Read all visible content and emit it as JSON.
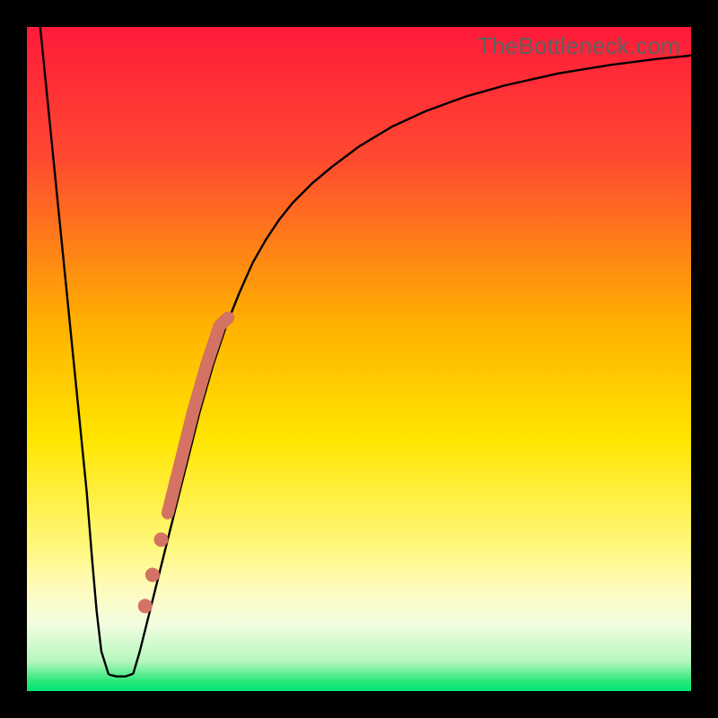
{
  "watermark": "TheBottleneck.com",
  "chart_data": {
    "type": "line",
    "title": "",
    "xlabel": "",
    "ylabel": "",
    "xlim": [
      0,
      100
    ],
    "ylim": [
      0,
      100
    ],
    "gradient_stops": [
      {
        "offset": 0.0,
        "color": "#ff1a3a"
      },
      {
        "offset": 0.2,
        "color": "#ff4a30"
      },
      {
        "offset": 0.45,
        "color": "#ffb200"
      },
      {
        "offset": 0.62,
        "color": "#ffe500"
      },
      {
        "offset": 0.78,
        "color": "#fff87a"
      },
      {
        "offset": 0.85,
        "color": "#fffbc0"
      },
      {
        "offset": 0.9,
        "color": "#f2fde0"
      },
      {
        "offset": 0.955,
        "color": "#b6f7bd"
      },
      {
        "offset": 0.985,
        "color": "#2be87a"
      },
      {
        "offset": 1.0,
        "color": "#00e676"
      }
    ],
    "series": [
      {
        "name": "left-branch",
        "x": [
          2,
          3,
          4,
          5,
          6,
          7,
          8,
          9,
          9.8,
          10.5,
          11.2,
          12.3
        ],
        "values": [
          100,
          90,
          80,
          70,
          60,
          50,
          40,
          30,
          20,
          12,
          6,
          2.5
        ]
      },
      {
        "name": "valley-floor",
        "x": [
          12.3,
          13.5,
          14.8,
          16.0
        ],
        "values": [
          2.5,
          2.2,
          2.2,
          2.6
        ]
      },
      {
        "name": "right-branch",
        "x": [
          16.0,
          17,
          18,
          19,
          20,
          21,
          22,
          23,
          24,
          25,
          26,
          27,
          28,
          29,
          30,
          32,
          34,
          36,
          38,
          40,
          43,
          46,
          50,
          55,
          60,
          66,
          72,
          80,
          88,
          95,
          100
        ],
        "values": [
          2.6,
          6,
          10,
          14,
          18,
          22,
          26,
          30,
          34,
          38,
          42,
          45.5,
          49,
          52,
          55,
          60,
          64.5,
          68,
          71,
          73.5,
          76.5,
          79,
          82,
          85,
          87.3,
          89.5,
          91.2,
          93,
          94.3,
          95.2,
          95.7
        ]
      }
    ],
    "highlight_segment": {
      "name": "bottleneck-range-major",
      "color": "#d47263",
      "width": 14,
      "x": [
        21.2,
        22,
        23,
        24,
        25,
        26,
        27,
        28,
        29,
        30.3
      ],
      "values": [
        26.8,
        30,
        34,
        38,
        42,
        45.5,
        49,
        52,
        55,
        56.2
      ]
    },
    "highlight_dots": {
      "name": "bottleneck-dots",
      "color": "#d47263",
      "radius": 8,
      "points": [
        {
          "x": 20.2,
          "y": 22.8
        },
        {
          "x": 18.9,
          "y": 17.5
        },
        {
          "x": 17.8,
          "y": 12.8
        }
      ]
    }
  }
}
